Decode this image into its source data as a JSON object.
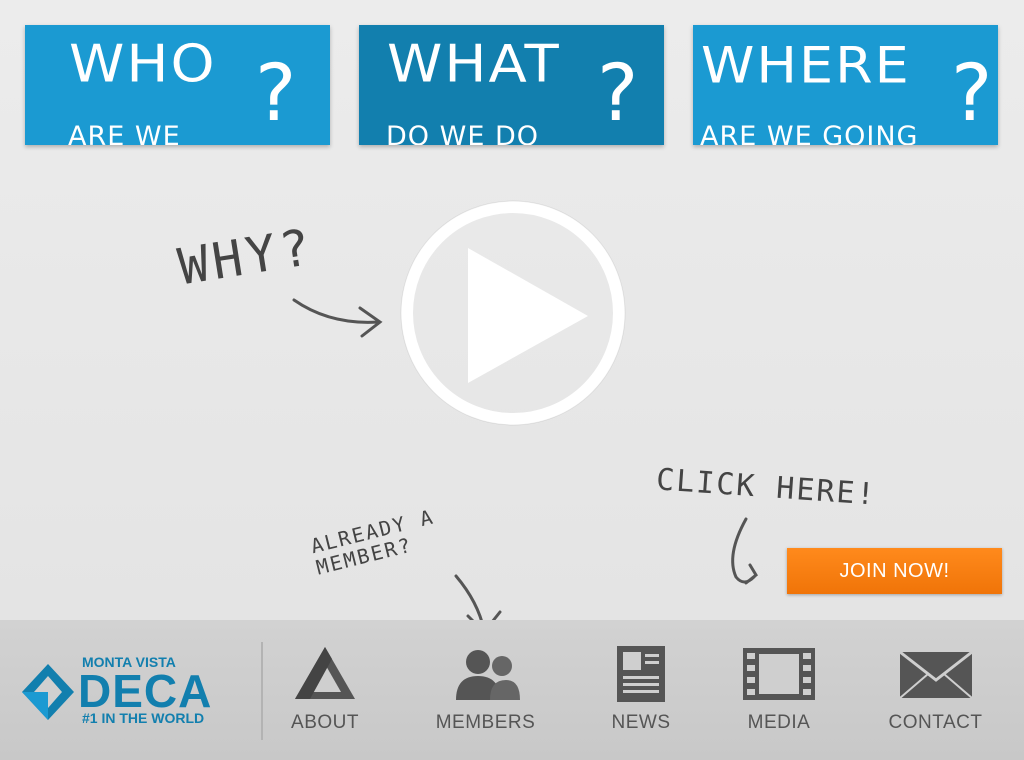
{
  "questions": [
    {
      "big": "WHO",
      "small": "ARE WE",
      "mark": "?"
    },
    {
      "big": "WHAT",
      "small": "DO WE DO",
      "mark": "?"
    },
    {
      "big": "WHERE",
      "small": "ARE WE GOING",
      "mark": "?"
    }
  ],
  "colors": {
    "accent_blue": "#1b9ad2",
    "accent_blue_dark": "#127fae",
    "join_orange": "#f37a0e"
  },
  "scribbles": {
    "why": "WHY?",
    "already_line1": "ALREADY A",
    "already_line2": "MEMBER?",
    "click_here": "CLICK HERE!"
  },
  "join_label": "JOIN NOW!",
  "logo": {
    "line1": "MONTA VISTA",
    "line2": "DECA",
    "line3": "#1 IN THE WORLD"
  },
  "nav": [
    {
      "label": "ABOUT",
      "icon": "triangle-logo-icon"
    },
    {
      "label": "MEMBERS",
      "icon": "users-icon"
    },
    {
      "label": "NEWS",
      "icon": "newspaper-icon"
    },
    {
      "label": "MEDIA",
      "icon": "film-icon"
    },
    {
      "label": "CONTACT",
      "icon": "envelope-icon"
    }
  ]
}
